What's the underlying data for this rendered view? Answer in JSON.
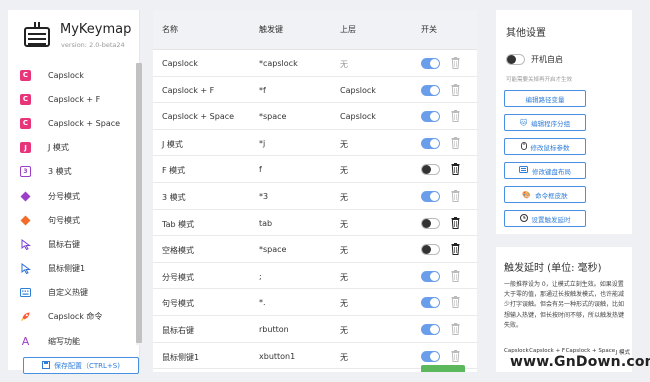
{
  "app": {
    "name": "MyKeymap",
    "version": "version: 2.0-beta24"
  },
  "sidebar": {
    "items": [
      {
        "label": "Capslock",
        "icon": "capslock-c-icon"
      },
      {
        "label": "Capslock + F",
        "icon": "capslock-c-icon"
      },
      {
        "label": "Capslock + Space",
        "icon": "capslock-c-icon"
      },
      {
        "label": "J 模式",
        "icon": "j-letter-icon"
      },
      {
        "label": "3 模式",
        "icon": "three-digit-icon"
      },
      {
        "label": "分号模式",
        "icon": "purple-diamond-icon"
      },
      {
        "label": "句号模式",
        "icon": "orange-diamond-icon"
      },
      {
        "label": "鼠标右键",
        "icon": "cursor-icon"
      },
      {
        "label": "鼠标侧键1",
        "icon": "cursor-icon"
      },
      {
        "label": "自定义热键",
        "icon": "keyboard-icon"
      },
      {
        "label": "Capslock 命令",
        "icon": "rocket-icon"
      },
      {
        "label": "缩写功能",
        "icon": "font-a-icon"
      }
    ],
    "save_label": "保存配置（CTRL+S)"
  },
  "table": {
    "headers": [
      "名称",
      "触发键",
      "上层",
      "开关"
    ],
    "rows": [
      {
        "name": "Capslock",
        "trigger": "*capslock",
        "parent": "无",
        "parent_gray": true,
        "enabled": true,
        "trash_dark": false
      },
      {
        "name": "Capslock + F",
        "trigger": "*f",
        "parent": "Capslock",
        "parent_gray": false,
        "enabled": true,
        "trash_dark": false
      },
      {
        "name": "Capslock + Space",
        "trigger": "*space",
        "parent": "Capslock",
        "parent_gray": false,
        "enabled": true,
        "trash_dark": false
      },
      {
        "name": "J 模式",
        "trigger": "*j",
        "parent": "无",
        "parent_gray": false,
        "enabled": true,
        "trash_dark": false
      },
      {
        "name": "F 模式",
        "trigger": "f",
        "parent": "无",
        "parent_gray": false,
        "enabled": false,
        "trash_dark": true
      },
      {
        "name": "3 模式",
        "trigger": "*3",
        "parent": "无",
        "parent_gray": false,
        "enabled": true,
        "trash_dark": false
      },
      {
        "name": "Tab 模式",
        "trigger": "tab",
        "parent": "无",
        "parent_gray": false,
        "enabled": false,
        "trash_dark": true
      },
      {
        "name": "空格模式",
        "trigger": "*space",
        "parent": "无",
        "parent_gray": false,
        "enabled": false,
        "trash_dark": true
      },
      {
        "name": "分号模式",
        "trigger": ";",
        "parent": "无",
        "parent_gray": false,
        "enabled": true,
        "trash_dark": false
      },
      {
        "name": "句号模式",
        "trigger": "*.",
        "parent": "无",
        "parent_gray": false,
        "enabled": true,
        "trash_dark": false
      },
      {
        "name": "鼠标右键",
        "trigger": "rbutton",
        "parent": "无",
        "parent_gray": false,
        "enabled": true,
        "trash_dark": false
      },
      {
        "name": "鼠标侧键1",
        "trigger": "xbutton1",
        "parent": "无",
        "parent_gray": false,
        "enabled": true,
        "trash_dark": false
      }
    ]
  },
  "settings": {
    "title": "其他设置",
    "autostart_label": "开机自启",
    "hint": "可能需要关掉再开启才生效",
    "buttons": [
      {
        "label": "编辑路径变量",
        "icon": ""
      },
      {
        "label": "编辑程序分组",
        "icon": "cat-icon"
      },
      {
        "label": "修改鼠标参数",
        "icon": "mouse-icon"
      },
      {
        "label": "修改键盘布局",
        "icon": "keyboard-icon"
      },
      {
        "label": "命令框皮肤",
        "icon": "palette-icon"
      },
      {
        "label": "设置触发延时",
        "icon": "clock-icon"
      }
    ]
  },
  "delay": {
    "title": "触发延时 (单位: 毫秒)",
    "text": "一般推荐设为 0，让模式立刻生效。如果设置大于零的值，那通过长按触发模式，也许能减少打字误触。但会有另一种形式的误触，比如想输入热键，但长按时间不够，所以触发热键失败。",
    "columns": [
      "Capslock",
      "Capslock + F",
      "Capslock + Space",
      "J 模式"
    ]
  },
  "colors": {
    "accent": "#2f7ed8",
    "toggle_on": "#6b9eea",
    "pink": "#e8357a",
    "purple": "#9b3fc6",
    "orange": "#f36c2a",
    "green": "#5cb85c"
  },
  "watermark": "www.GnDown.com"
}
